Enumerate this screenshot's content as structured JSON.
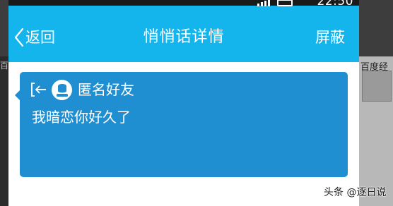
{
  "background": {
    "right_text": "百度经",
    "left_char": "百"
  },
  "status_bar": {
    "time": "22:50"
  },
  "nav": {
    "back_label": "返回",
    "title": "悄悄话详情",
    "action_label": "屏蔽"
  },
  "message": {
    "sender_name": "匿名好友",
    "text": "我暗恋你好久了"
  },
  "watermark": "头条 @逐日说",
  "colors": {
    "nav_bar": "#14b4ec",
    "bubble": "#1f8fd1",
    "content_bg": "#ffffff"
  },
  "icons": {
    "back": "chevron-left-icon",
    "exit": "exit-arrow-icon",
    "avatar": "anonymous-person-icon",
    "signal": "signal-icon",
    "battery": "battery-icon"
  }
}
